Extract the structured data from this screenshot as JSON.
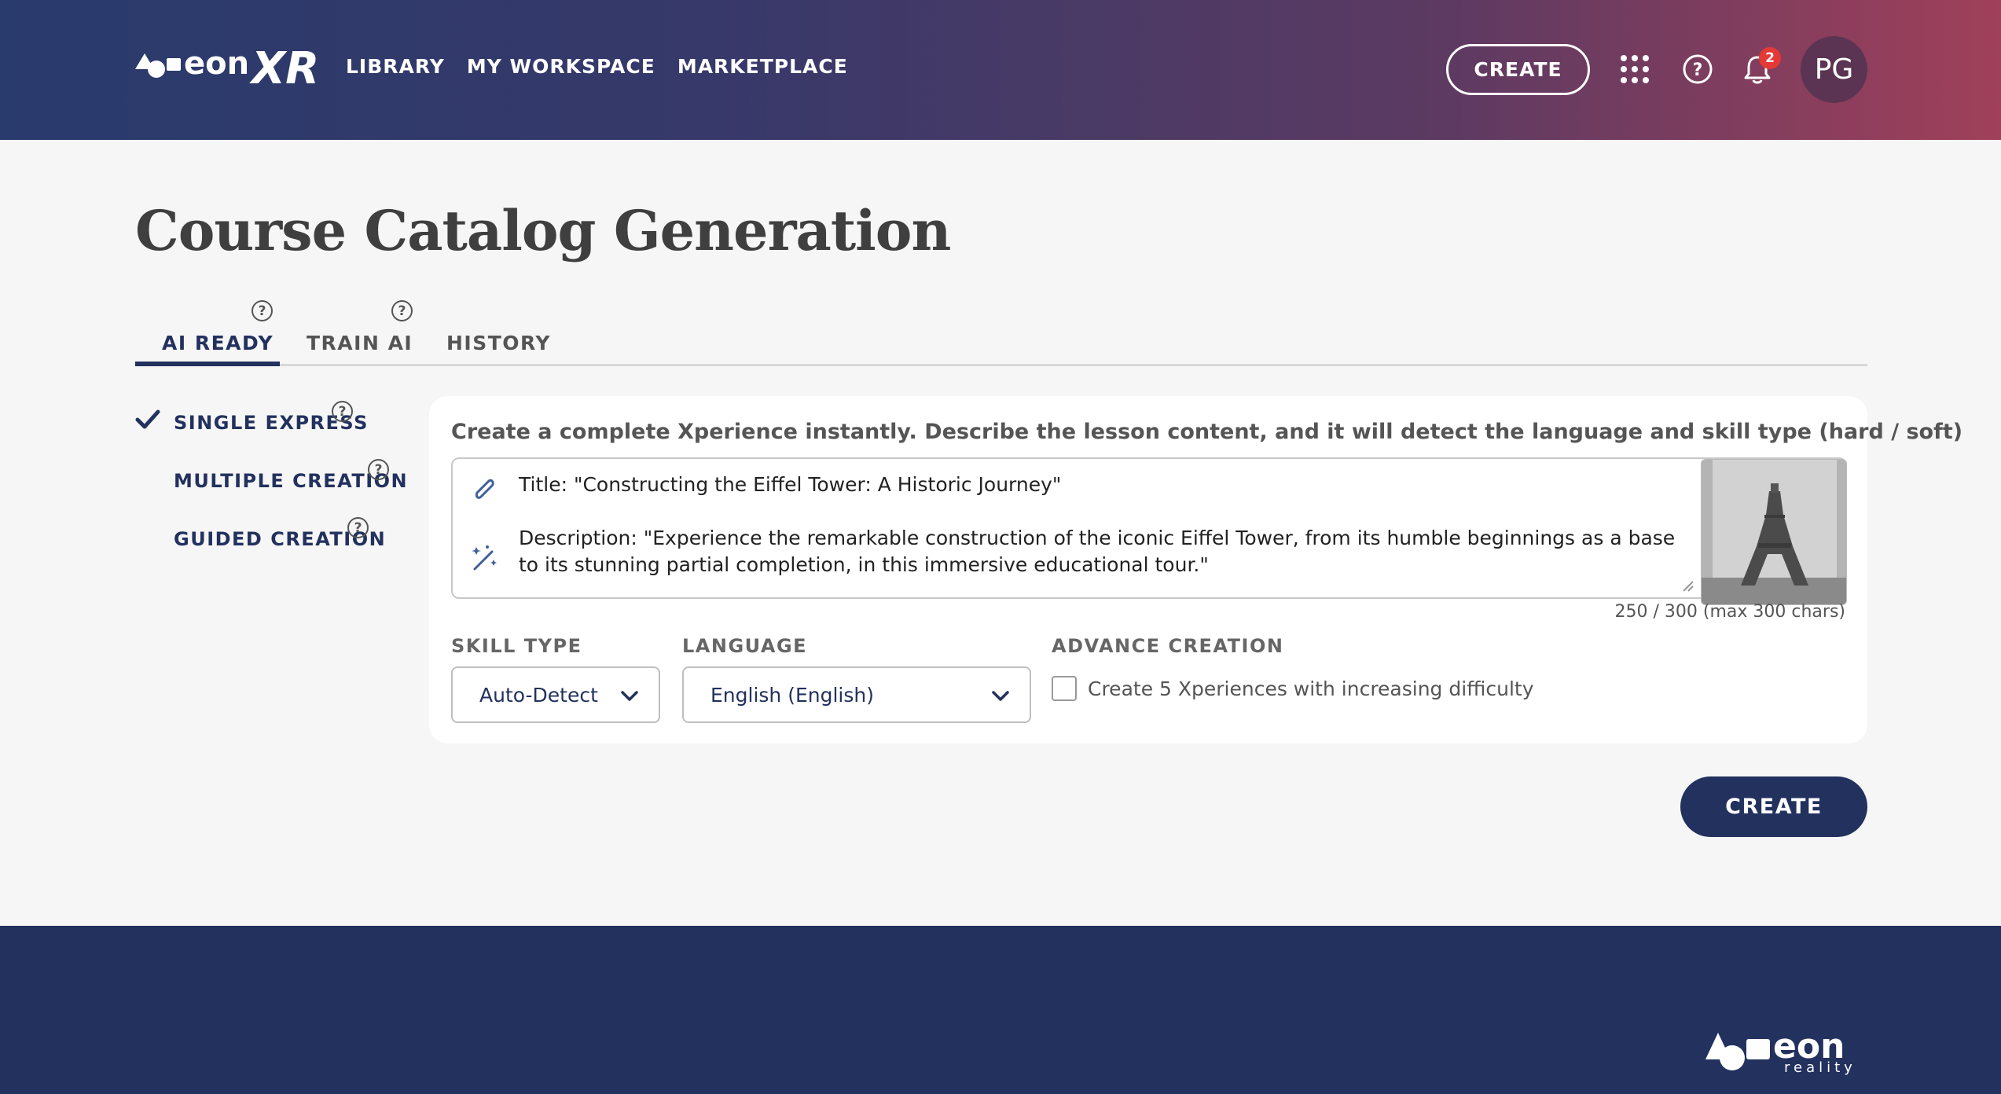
{
  "header": {
    "logo_alt": "eonXR",
    "nav": [
      "LIBRARY",
      "MY WORKSPACE",
      "MARKETPLACE"
    ],
    "create_label": "CREATE",
    "notification_count": "2",
    "avatar_initials": "PG",
    "icons": [
      "apps-grid-icon",
      "help-circle-icon",
      "bell-icon"
    ]
  },
  "page": {
    "title": "Course Catalog Generation",
    "tabs": [
      {
        "label": "AI READY",
        "active": true,
        "help": "?"
      },
      {
        "label": "TRAIN AI",
        "active": false,
        "help": "?"
      },
      {
        "label": "HISTORY",
        "active": false
      }
    ]
  },
  "sidebar": {
    "items": [
      {
        "label": "SINGLE EXPRESS",
        "selected": true,
        "help": "?"
      },
      {
        "label": "MULTIPLE CREATION",
        "selected": false,
        "help": "?"
      },
      {
        "label": "GUIDED CREATION",
        "selected": false,
        "help": "?"
      }
    ]
  },
  "form": {
    "intro": "Create a complete Xperience instantly. Describe the lesson content, and it will detect the language and skill type (hard / soft)",
    "prompt_title": "Title: \"Constructing the Eiffel Tower: A Historic Journey\"",
    "prompt_description": "Description: \"Experience the remarkable construction of the iconic Eiffel Tower, from its humble beginnings as a base to its stunning partial completion, in this immersive educational tour.\"",
    "char_count": "250 / 300 (max 300 chars)",
    "skill_type": {
      "label": "SKILL TYPE",
      "value": "Auto-Detect"
    },
    "language": {
      "label": "LANGUAGE",
      "value": "English (English)"
    },
    "advance": {
      "label": "ADVANCE CREATION",
      "checkbox_label": "Create 5 Xperiences with increasing difficulty",
      "checked": false
    },
    "create_label": "CREATE"
  },
  "footer": {
    "logo_alt": "eon reality"
  },
  "colors": {
    "primary": "#22315e",
    "header_start": "#293a6c",
    "header_end": "#a0405a",
    "badge": "#e53935",
    "background": "#f6f6f6"
  }
}
